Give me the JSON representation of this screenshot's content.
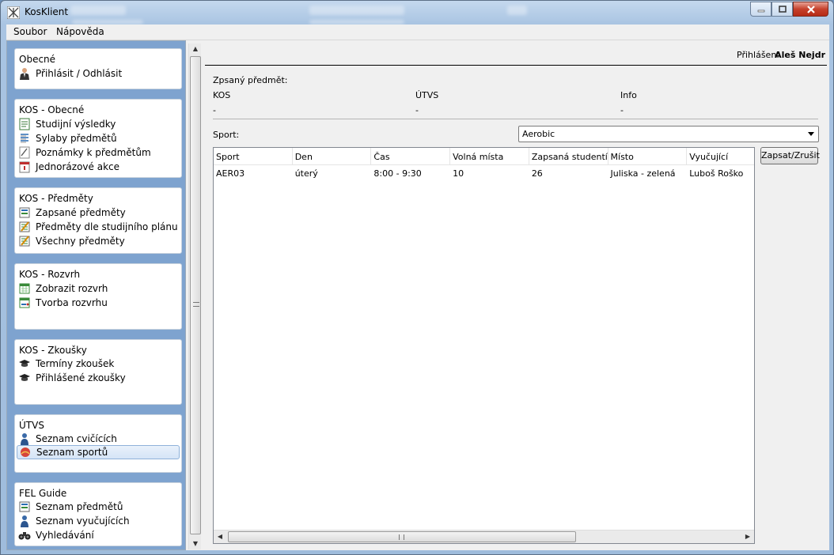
{
  "window": {
    "title": "KosKlient"
  },
  "menu": {
    "items": [
      "Soubor",
      "Nápověda"
    ]
  },
  "sidebar": {
    "groups": [
      {
        "title": "Obecné",
        "items": [
          {
            "label": "Přihlásit / Odhlásit",
            "icon": "user-icon"
          }
        ]
      },
      {
        "title": "KOS - Obecné",
        "items": [
          {
            "label": "Studijní výsledky",
            "icon": "results-icon"
          },
          {
            "label": "Sylaby předmětů",
            "icon": "syllabus-icon"
          },
          {
            "label": "Poznámky k předmětům",
            "icon": "notes-icon"
          },
          {
            "label": "Jednorázové akce",
            "icon": "event-icon"
          }
        ]
      },
      {
        "title": "KOS - Předměty",
        "items": [
          {
            "label": "Zapsané předměty",
            "icon": "list-icon"
          },
          {
            "label": "Předměty dle studijního plánu",
            "icon": "plan-icon"
          },
          {
            "label": "Všechny předměty",
            "icon": "plan-icon"
          }
        ]
      },
      {
        "title": "KOS - Rozvrh",
        "items": [
          {
            "label": "Zobrazit rozvrh",
            "icon": "calendar-icon"
          },
          {
            "label": "Tvorba rozvrhu",
            "icon": "calendar-edit-icon"
          }
        ]
      },
      {
        "title": "KOS - Zkoušky",
        "items": [
          {
            "label": "Termíny zkoušek",
            "icon": "graduation-cap-icon"
          },
          {
            "label": "Přihlášené zkoušky",
            "icon": "graduation-cap-icon"
          }
        ]
      },
      {
        "title": "ÚTVS",
        "items": [
          {
            "label": "Seznam cvičících",
            "icon": "person-icon"
          },
          {
            "label": "Seznam sportů",
            "icon": "ball-icon",
            "selected": true
          }
        ]
      },
      {
        "title": "FEL Guide",
        "items": [
          {
            "label": "Seznam předmětů",
            "icon": "list-icon"
          },
          {
            "label": "Seznam vyučujících",
            "icon": "person-icon"
          },
          {
            "label": "Vyhledávání",
            "icon": "binoculars-icon"
          }
        ]
      }
    ]
  },
  "main": {
    "login_label": "Přihlášen:",
    "login_user": "Aleš Nejdr",
    "enrolled_label": "Zpsaný předmět:",
    "cols": {
      "kos": "KOS",
      "kos_value": "-",
      "utvs": "ÚTVS",
      "utvs_value": "-",
      "info": "Info",
      "info_value": "-"
    },
    "sport_label": "Sport:",
    "sport_selected": "Aerobic",
    "table": {
      "headers": [
        "Sport",
        "Den",
        "Čas",
        "Volná místa",
        "Zapsaná studentí",
        "Místo",
        "Vyučující"
      ],
      "rows": [
        [
          "AER03",
          "úterý",
          "8:00 - 9:30",
          "10",
          "26",
          "Juliska - zelená",
          "Luboš Roško"
        ]
      ]
    },
    "enroll_button": "Zapsat/Zrušit"
  }
}
